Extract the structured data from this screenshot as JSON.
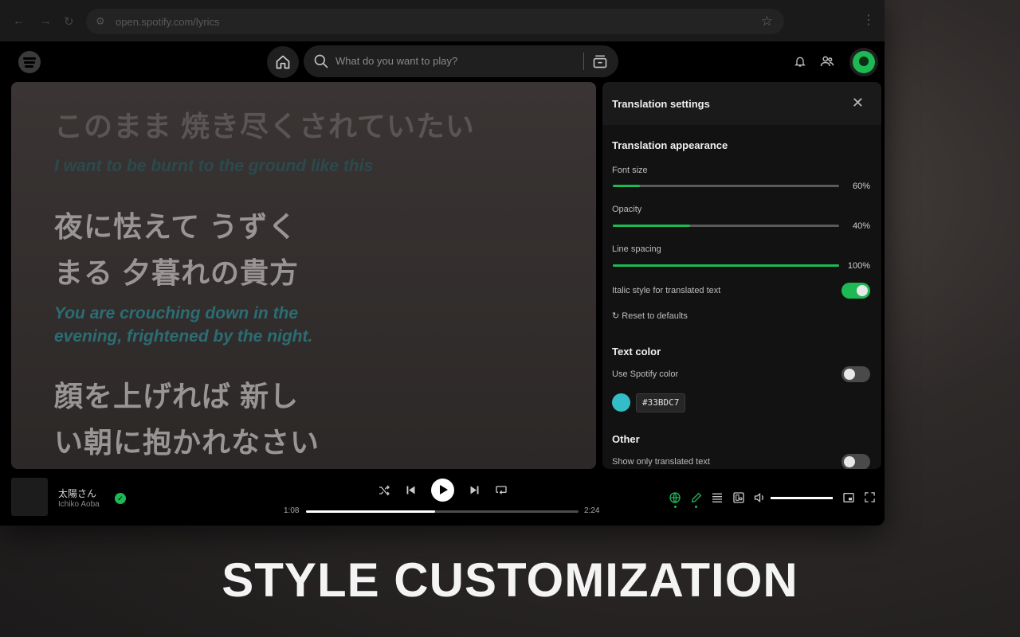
{
  "browser": {
    "url": "open.spotify.com/lyrics"
  },
  "topbar": {
    "search_placeholder": "What do you want to play?"
  },
  "lyrics": {
    "lines": [
      {
        "jp": "このまま 焼き尽くされていたい",
        "en": "I want to be burnt to the ground like this"
      },
      {
        "jp1": "夜に怯えて うずく",
        "jp2": "まる 夕暮れの貴方",
        "en1": "You are crouching down in the",
        "en2": "evening, frightened by the night."
      },
      {
        "jp1": "顔を上げれば 新し",
        "jp2": "い朝に抱かれなさい"
      }
    ]
  },
  "settings": {
    "title": "Translation settings",
    "appearance": {
      "title": "Translation appearance",
      "font_size": {
        "label": "Font size",
        "value": 60,
        "display": "60%"
      },
      "opacity": {
        "label": "Opacity",
        "value": 40,
        "display": "40%"
      },
      "line_spacing": {
        "label": "Line spacing",
        "value": 100,
        "display": "100%"
      },
      "italic": {
        "label": "Italic style for translated text",
        "on": true
      },
      "reset_label": "Reset to defaults"
    },
    "text_color": {
      "title": "Text color",
      "use_spotify": {
        "label": "Use Spotify color",
        "on": false
      },
      "hex": "#33BDC7"
    },
    "other": {
      "title": "Other",
      "only_translated": {
        "label": "Show only translated text",
        "on": false
      }
    }
  },
  "player": {
    "title": "太陽さん",
    "artist": "Ichiko Aoba",
    "elapsed": "1:08",
    "duration": "2:24",
    "progress": 0.475,
    "volume": 1.0
  },
  "caption": "STYLE CUSTOMIZATION",
  "colors": {
    "accent": "#1DB954",
    "translation": "#33BDC7"
  }
}
